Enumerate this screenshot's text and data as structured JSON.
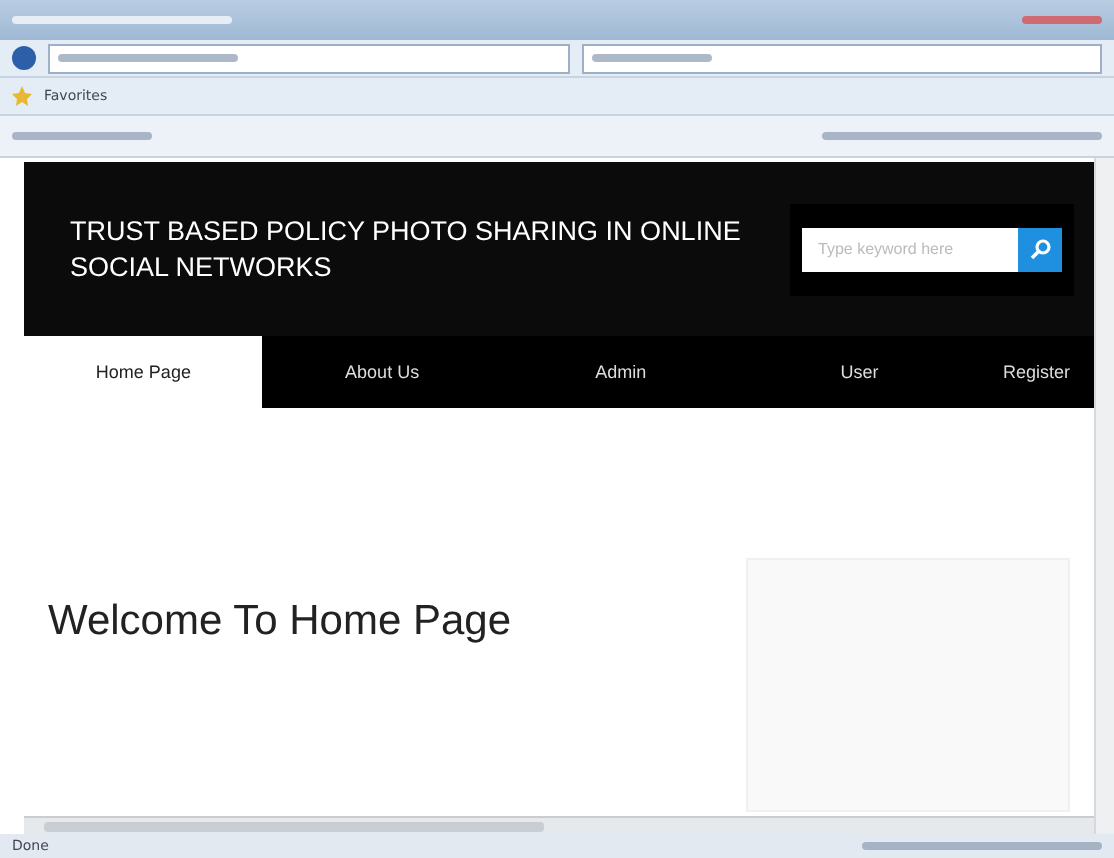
{
  "favorites_bar": {
    "label": "Favorites"
  },
  "header": {
    "title": "TRUST BASED POLICY PHOTO SHARING IN ONLINE SOCIAL NETWORKS",
    "search": {
      "placeholder": "Type keyword here"
    }
  },
  "nav": [
    {
      "label": "Home Page",
      "selected": true
    },
    {
      "label": "About Us",
      "selected": false
    },
    {
      "label": "Admin",
      "selected": false
    },
    {
      "label": "User",
      "selected": false
    },
    {
      "label": "Register",
      "selected": false
    }
  ],
  "content": {
    "heading": "Welcome To Home Page"
  },
  "status_bar": {
    "text": "Done"
  }
}
